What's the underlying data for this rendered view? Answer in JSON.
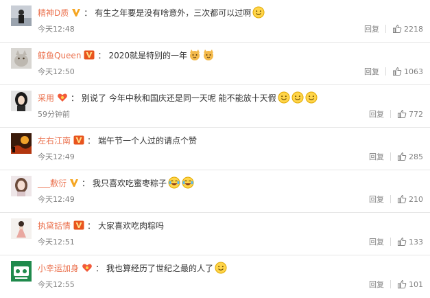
{
  "comments": [
    {
      "username": "精神D质",
      "badge": "vip-v-yellow",
      "text": "有生之年要是没有啥意外，三次都可以过啊",
      "emojis": [
        "smile"
      ],
      "time": "今天12:48",
      "reply": "回复",
      "likes": "2218"
    },
    {
      "username": "鲸鱼Queen",
      "badge": "vip-v-red",
      "text": "2020就是特别的一年",
      "emojis": [
        "cat",
        "cat"
      ],
      "time": "今天12:50",
      "reply": "回复",
      "likes": "1063"
    },
    {
      "username": "采用",
      "badge": "fan-heart",
      "text": "别说了 今年中秋和国庆还是同一天呢 能不能放十天假",
      "emojis": [
        "smile",
        "smile",
        "smile"
      ],
      "time": "59分钟前",
      "reply": "回复",
      "likes": "772"
    },
    {
      "username": "左右江南",
      "badge": "vip-v-red",
      "text": "端午节一个人过的请点个赞",
      "emojis": [],
      "time": "今天12:49",
      "reply": "回复",
      "likes": "285"
    },
    {
      "username": "___敷衍",
      "badge": "vip-v-yellow",
      "text": "我只喜欢吃蜜枣粽子",
      "emojis": [
        "laugh-tears",
        "laugh-tears"
      ],
      "time": "今天12:49",
      "reply": "回复",
      "likes": "210"
    },
    {
      "username": "执黛話情",
      "badge": "vip-v-red",
      "text": "大家喜欢吃肉粽吗",
      "emojis": [],
      "time": "今天12:51",
      "reply": "回复",
      "likes": "133"
    },
    {
      "username": "小幸运加身",
      "badge": "fan-heart",
      "text": "我也算经历了世纪之最的人了",
      "emojis": [
        "smile"
      ],
      "time": "今天12:55",
      "reply": "回复",
      "likes": "101"
    }
  ],
  "colors": {
    "username": "#eb7350",
    "text": "#333333",
    "meta": "#808080",
    "divider": "#e6e6e6"
  }
}
